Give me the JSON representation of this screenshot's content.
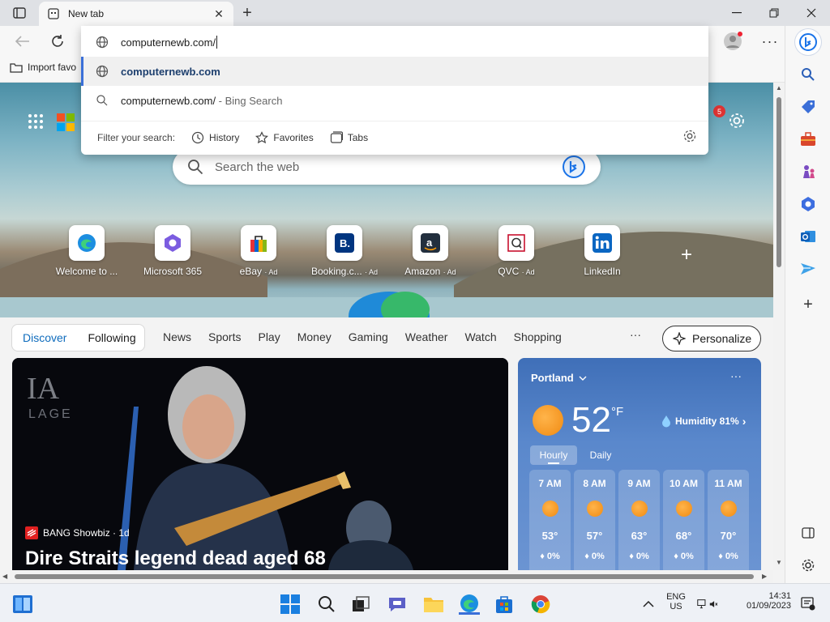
{
  "browser": {
    "tab_title": "New tab",
    "address_value": "computernewb.com/",
    "suggestion_primary": "computernewb.com",
    "suggestion_search_query": "computernewb.com/",
    "suggestion_search_suffix": " - Bing Search",
    "filter_label": "Filter your search:",
    "filter_history": "History",
    "filter_favorites": "Favorites",
    "filter_tabs": "Tabs",
    "import_favorites": "Import favo"
  },
  "newtab": {
    "notification_count": "5",
    "search_placeholder": "Search the web",
    "quick_links": [
      {
        "label": "Welcome to ...",
        "ad": ""
      },
      {
        "label": "Microsoft 365",
        "ad": ""
      },
      {
        "label": "eBay",
        "ad": "· Ad"
      },
      {
        "label": "Booking.c...",
        "ad": "· Ad"
      },
      {
        "label": "Amazon",
        "ad": "· Ad"
      },
      {
        "label": "QVC",
        "ad": "· Ad"
      },
      {
        "label": "LinkedIn",
        "ad": ""
      }
    ]
  },
  "feed": {
    "seg_discover": "Discover",
    "seg_following": "Following",
    "nav": [
      "News",
      "Sports",
      "Play",
      "Money",
      "Gaming",
      "Weather",
      "Watch",
      "Shopping"
    ],
    "more": "···",
    "personalize": "Personalize",
    "news_source": "BANG Showbiz · 1d",
    "news_headline": "Dire Straits legend dead aged 68"
  },
  "weather": {
    "city": "Portland",
    "temp": "52",
    "unit": "°F",
    "humidity": "Humidity 81%",
    "tab_hourly": "Hourly",
    "tab_daily": "Daily",
    "more": "···",
    "hours": [
      {
        "time": "7 AM",
        "temp": "53°",
        "precip": "0%"
      },
      {
        "time": "8 AM",
        "temp": "57°",
        "precip": "0%"
      },
      {
        "time": "9 AM",
        "temp": "63°",
        "precip": "0%"
      },
      {
        "time": "10 AM",
        "temp": "68°",
        "precip": "0%"
      },
      {
        "time": "11 AM",
        "temp": "70°",
        "precip": "0%"
      }
    ]
  },
  "taskbar": {
    "lang_top": "ENG",
    "lang_bottom": "US",
    "time": "14:31",
    "date": "01/09/2023"
  }
}
